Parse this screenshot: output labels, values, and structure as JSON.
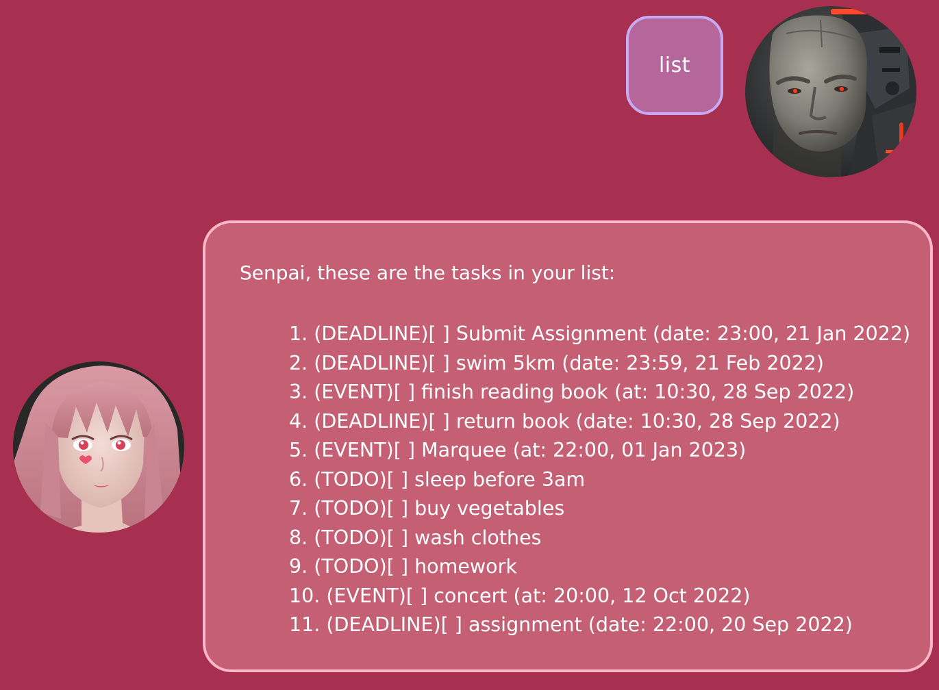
{
  "user_message": {
    "text": "list",
    "avatar_icon": "cyborg-man-avatar"
  },
  "bot_message": {
    "intro": "Senpai, these are the tasks in your list:",
    "avatar_icon": "anime-girl-avatar",
    "tasks": [
      "1. (DEADLINE)[ ] Submit Assignment (date: 23:00, 21 Jan 2022)",
      "2. (DEADLINE)[ ] swim 5km (date: 23:59, 21 Feb 2022)",
      "3. (EVENT)[ ] finish reading book (at: 10:30, 28 Sep 2022)",
      "4. (DEADLINE)[ ] return book (date: 10:30, 28 Sep 2022)",
      "5. (EVENT)[ ] Marquee (at: 22:00, 01 Jan 2023)",
      "6. (TODO)[ ] sleep before 3am",
      "7. (TODO)[ ] buy vegetables",
      "8. (TODO)[ ] wash clothes",
      "9. (TODO)[ ] homework",
      "10. (EVENT)[ ] concert (at: 20:00, 12 Oct 2022)",
      "11. (DEADLINE)[ ] assignment (date: 22:00, 20 Sep 2022)"
    ]
  },
  "colors": {
    "background": "#a72f50",
    "user_bubble": "#b5679b",
    "user_bubble_border": "#c9aaf2",
    "bot_bubble": "#c55f74",
    "bot_bubble_border": "#ffb6c6",
    "text": "#ffffff"
  }
}
